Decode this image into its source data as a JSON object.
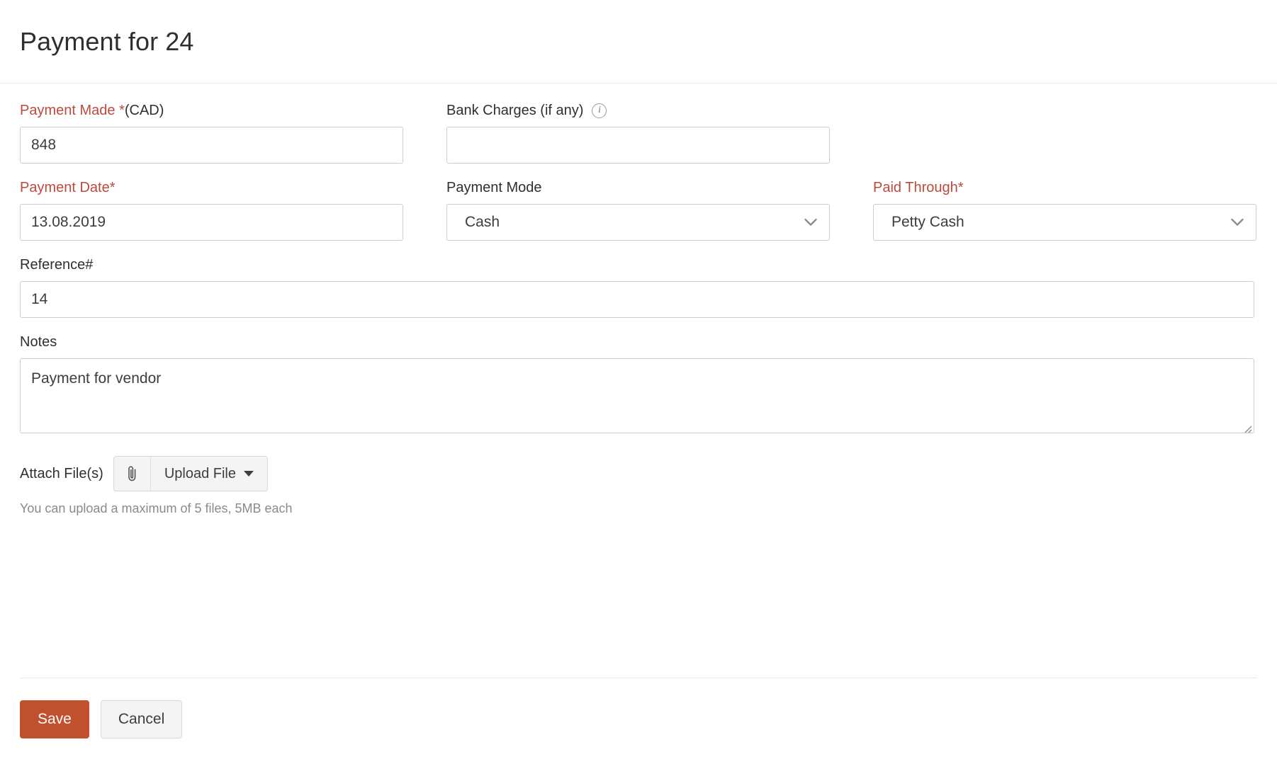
{
  "header": {
    "title": "Payment for 24"
  },
  "form": {
    "payment_made": {
      "label": "Payment Made *",
      "label_suffix": "(CAD)",
      "value": "848",
      "placeholder": ""
    },
    "bank_charges": {
      "label": "Bank Charges (if any)",
      "value": "",
      "placeholder": "",
      "info_glyph": "i"
    },
    "payment_date": {
      "label": "Payment Date*",
      "value": "13.08.2019",
      "placeholder": ""
    },
    "payment_mode": {
      "label": "Payment Mode",
      "value": "Cash"
    },
    "paid_through": {
      "label": "Paid Through*",
      "value": "Petty Cash"
    },
    "reference": {
      "label": "Reference#",
      "value": "14",
      "placeholder": ""
    },
    "notes": {
      "label": "Notes",
      "value": "Payment for vendor",
      "placeholder": ""
    },
    "attach": {
      "label": "Attach File(s)",
      "clip_glyph": "\u0001F4CE",
      "upload_label": "Upload File",
      "hint": "You can upload a maximum of 5 files, 5MB each"
    }
  },
  "footer": {
    "save_label": "Save",
    "cancel_label": "Cancel"
  },
  "colors": {
    "required_label": "#bc4a3c",
    "save_button": "#c1502e",
    "border": "#cccccc",
    "hint_text": "#8a8a8a"
  }
}
